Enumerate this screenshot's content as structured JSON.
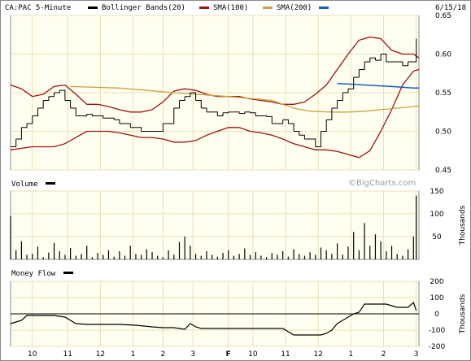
{
  "header": {
    "symbol_title": "CA:PAC 5-Minute",
    "legend": [
      {
        "label": "Bollinger Bands(20)",
        "color": "#000000"
      },
      {
        "label": "SMA(100)",
        "color": "#a01010"
      },
      {
        "label": "SMA(200)",
        "color": "#d0a040"
      },
      {
        "label": "",
        "color": "#1060c0"
      }
    ],
    "date": "6/15/18"
  },
  "colors": {
    "price": "#000000",
    "bollinger": "#a01010",
    "sma100": "#a01010",
    "sma200": "#d0a040",
    "blue": "#1060c0",
    "grid": "#e8e0b8",
    "panel_bg": "#fffff0"
  },
  "volume_panel": {
    "label": "Volume",
    "watermark": "©BigCharts.com",
    "unit": "Thousands"
  },
  "moneyflow_panel": {
    "label": "Money Flow",
    "unit": "Thousands"
  },
  "chart_data": [
    {
      "type": "line",
      "panel": "price",
      "x_tick_labels": [
        "10",
        "11",
        "12",
        "1",
        "2",
        "3",
        "F",
        "10",
        "11",
        "12",
        "1",
        "2",
        "3"
      ],
      "y_ticks": [
        0.45,
        0.5,
        0.55,
        0.6,
        0.65
      ],
      "y_tick_labels": [
        "0.45",
        "0.50",
        "0.55",
        "0.60",
        "0.65"
      ],
      "ylim": [
        0.45,
        0.65
      ],
      "xlim": [
        0,
        150
      ],
      "grid": true,
      "series": [
        {
          "name": "CA:PAC",
          "x": [
            0,
            2,
            4,
            6,
            8,
            10,
            12,
            14,
            16,
            18,
            20,
            22,
            24,
            28,
            30,
            34,
            38,
            40,
            44,
            48,
            52,
            56,
            60,
            62,
            64,
            66,
            68,
            70,
            72,
            74,
            76,
            78,
            80,
            82,
            84,
            86,
            88,
            90,
            92,
            94,
            96,
            98,
            100,
            102,
            104,
            106,
            108,
            110,
            112,
            114,
            116,
            118,
            120,
            122,
            124,
            126,
            128,
            130,
            132,
            134,
            136,
            138,
            140,
            142,
            144,
            146,
            148,
            149
          ],
          "y": [
            0.48,
            0.49,
            0.505,
            0.51,
            0.52,
            0.53,
            0.54,
            0.545,
            0.55,
            0.553,
            0.54,
            0.53,
            0.52,
            0.522,
            0.52,
            0.517,
            0.515,
            0.51,
            0.505,
            0.5,
            0.5,
            0.51,
            0.53,
            0.54,
            0.545,
            0.55,
            0.54,
            0.53,
            0.525,
            0.525,
            0.52,
            0.524,
            0.525,
            0.525,
            0.523,
            0.525,
            0.524,
            0.52,
            0.52,
            0.519,
            0.51,
            0.51,
            0.515,
            0.51,
            0.5,
            0.495,
            0.49,
            0.49,
            0.48,
            0.5,
            0.515,
            0.53,
            0.54,
            0.55,
            0.555,
            0.57,
            0.58,
            0.59,
            0.595,
            0.592,
            0.6,
            0.59,
            0.59,
            0.59,
            0.585,
            0.59,
            0.59,
            0.62
          ]
        },
        {
          "name": "Bollinger Bands(20)",
          "x": [
            0,
            4,
            8,
            12,
            16,
            20,
            24,
            28,
            32,
            36,
            40,
            44,
            48,
            52,
            56,
            60,
            64,
            68,
            72,
            76,
            80,
            84,
            88,
            92,
            96,
            100,
            104,
            108,
            112,
            116,
            120,
            124,
            128,
            132,
            136,
            140,
            144,
            148,
            150
          ],
          "upper": [
            0.56,
            0.555,
            0.545,
            0.548,
            0.558,
            0.56,
            0.548,
            0.535,
            0.535,
            0.532,
            0.528,
            0.525,
            0.525,
            0.528,
            0.538,
            0.552,
            0.555,
            0.553,
            0.548,
            0.545,
            0.545,
            0.545,
            0.542,
            0.54,
            0.538,
            0.535,
            0.535,
            0.538,
            0.548,
            0.56,
            0.58,
            0.6,
            0.618,
            0.622,
            0.62,
            0.605,
            0.6,
            0.6,
            0.595
          ],
          "lower": [
            0.476,
            0.478,
            0.48,
            0.48,
            0.48,
            0.484,
            0.492,
            0.5,
            0.5,
            0.5,
            0.498,
            0.495,
            0.492,
            0.492,
            0.49,
            0.486,
            0.486,
            0.488,
            0.495,
            0.5,
            0.505,
            0.505,
            0.5,
            0.498,
            0.495,
            0.49,
            0.484,
            0.48,
            0.476,
            0.476,
            0.474,
            0.47,
            0.466,
            0.475,
            0.5,
            0.528,
            0.56,
            0.578,
            0.58
          ]
        },
        {
          "name": "SMA(100)",
          "x": [
            0,
            20,
            40,
            60,
            80,
            100,
            110,
            120,
            128,
            132,
            136,
            140,
            144,
            148,
            150
          ],
          "y": [
            0.52,
            0.522,
            0.518,
            0.52,
            0.522,
            0.52,
            0.505,
            0.49,
            0.475,
            0.48,
            0.5,
            0.54,
            0.565,
            0.578,
            0.578
          ]
        },
        {
          "name": "SMA(200)",
          "x": [
            22,
            40,
            60,
            80,
            96,
            100,
            104,
            110,
            118,
            124,
            130,
            136,
            142,
            148,
            150
          ],
          "y": [
            0.558,
            0.556,
            0.55,
            0.545,
            0.54,
            0.535,
            0.53,
            0.526,
            0.525,
            0.525,
            0.526,
            0.528,
            0.53,
            0.532,
            0.533
          ]
        },
        {
          "name": "",
          "x": [
            120,
            130,
            140,
            148,
            150
          ],
          "y": [
            0.562,
            0.56,
            0.558,
            0.556,
            0.556
          ]
        }
      ]
    },
    {
      "type": "bar",
      "panel": "volume",
      "ylabel": "Thousands",
      "y_ticks": [
        0,
        50,
        100,
        150
      ],
      "y_tick_labels": [
        "",
        "50",
        "100",
        "150"
      ],
      "ylim": [
        0,
        150
      ],
      "xlim": [
        0,
        150
      ],
      "x": [
        0,
        2,
        4,
        6,
        8,
        10,
        12,
        14,
        16,
        18,
        20,
        22,
        24,
        26,
        28,
        30,
        32,
        34,
        36,
        38,
        40,
        42,
        44,
        46,
        48,
        50,
        52,
        54,
        56,
        58,
        60,
        62,
        64,
        66,
        68,
        70,
        72,
        74,
        76,
        78,
        80,
        82,
        84,
        86,
        88,
        90,
        92,
        94,
        96,
        98,
        100,
        102,
        104,
        106,
        108,
        110,
        112,
        114,
        116,
        118,
        120,
        122,
        124,
        126,
        128,
        130,
        132,
        134,
        136,
        138,
        140,
        142,
        144,
        146,
        148,
        149
      ],
      "values": [
        95,
        20,
        40,
        10,
        12,
        28,
        5,
        15,
        36,
        18,
        10,
        25,
        8,
        12,
        30,
        5,
        14,
        10,
        20,
        6,
        18,
        8,
        30,
        12,
        10,
        22,
        16,
        8,
        5,
        20,
        10,
        38,
        50,
        30,
        12,
        8,
        18,
        10,
        6,
        14,
        20,
        8,
        12,
        24,
        10,
        16,
        8,
        5,
        14,
        10,
        18,
        6,
        22,
        12,
        8,
        16,
        10,
        26,
        20,
        12,
        35,
        10,
        28,
        60,
        20,
        80,
        30,
        55,
        40,
        18,
        30,
        12,
        8,
        22,
        50,
        140
      ]
    },
    {
      "type": "line",
      "panel": "moneyflow",
      "ylabel": "Thousands",
      "y_ticks": [
        -200,
        -100,
        0,
        100,
        200
      ],
      "y_tick_labels": [
        "-200",
        "-100",
        "0",
        "100",
        "200"
      ],
      "ylim": [
        -200,
        200
      ],
      "xlim": [
        0,
        150
      ],
      "series": [
        {
          "name": "Money Flow",
          "x": [
            0,
            2,
            4,
            6,
            8,
            10,
            12,
            16,
            20,
            24,
            28,
            34,
            40,
            46,
            52,
            56,
            60,
            62,
            64,
            66,
            68,
            70,
            74,
            80,
            86,
            92,
            96,
            100,
            102,
            104,
            106,
            110,
            114,
            116,
            118,
            120,
            122,
            124,
            126,
            128,
            130,
            134,
            138,
            142,
            146,
            148,
            149
          ],
          "y": [
            -60,
            -50,
            -40,
            -10,
            -10,
            -10,
            -10,
            -10,
            -20,
            -60,
            -65,
            -65,
            -65,
            -70,
            -80,
            -85,
            -85,
            -90,
            -95,
            -60,
            -80,
            -90,
            -90,
            -90,
            -90,
            -90,
            -90,
            -90,
            -110,
            -130,
            -130,
            -130,
            -130,
            -120,
            -100,
            -60,
            -40,
            -20,
            0,
            10,
            60,
            60,
            60,
            40,
            40,
            70,
            20
          ]
        }
      ]
    }
  ]
}
